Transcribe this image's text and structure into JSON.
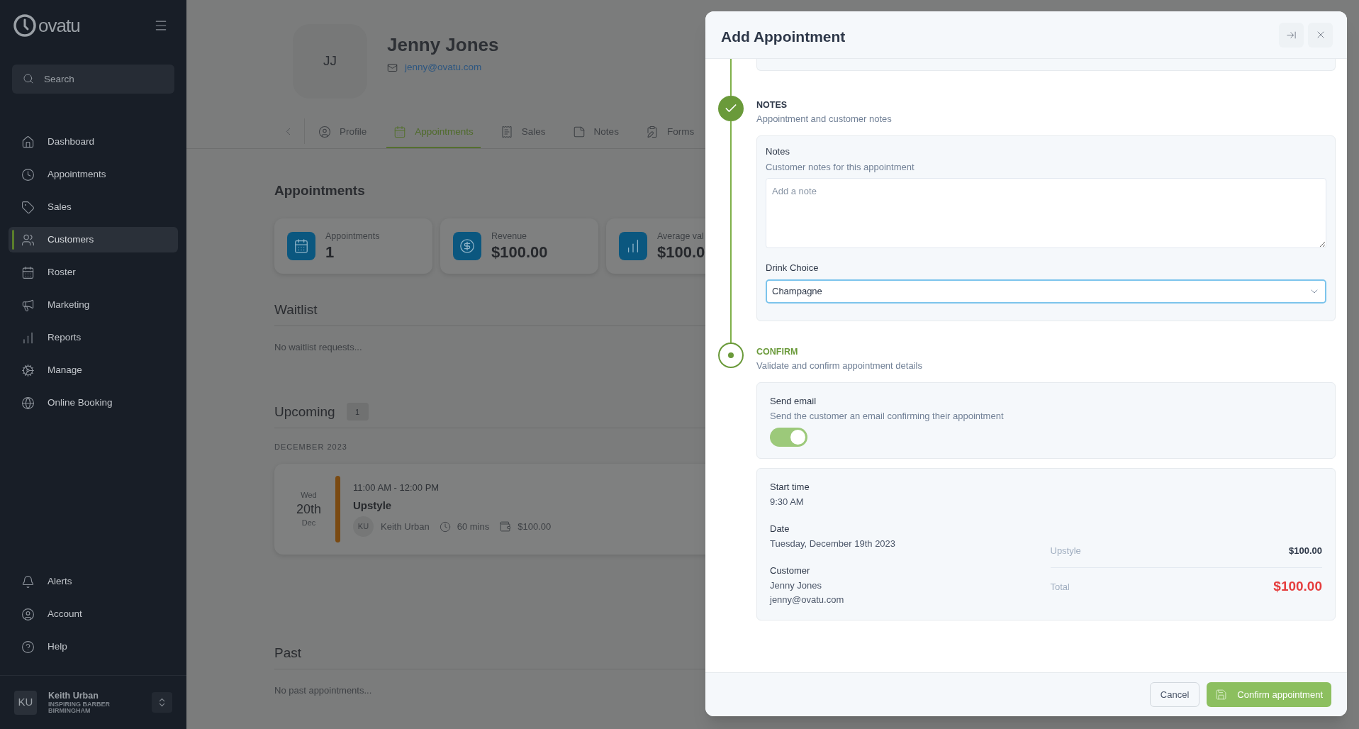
{
  "sidebar": {
    "logo": "ovatu",
    "search": {
      "placeholder": "Search"
    },
    "nav": [
      {
        "label": "Dashboard",
        "selected": false
      },
      {
        "label": "Appointments",
        "selected": false
      },
      {
        "label": "Sales",
        "selected": false
      },
      {
        "label": "Customers",
        "selected": true
      },
      {
        "label": "Roster",
        "selected": false
      },
      {
        "label": "Marketing",
        "selected": false
      },
      {
        "label": "Reports",
        "selected": false
      },
      {
        "label": "Manage",
        "selected": false
      },
      {
        "label": "Online Booking",
        "selected": false
      }
    ],
    "bottom_nav": [
      {
        "label": "Alerts",
        "selected": false
      },
      {
        "label": "Account",
        "selected": false
      },
      {
        "label": "Help",
        "selected": false
      }
    ],
    "user": {
      "initials": "KU",
      "name": "Keith Urban",
      "org": "INSPIRING BARBER BIRMINGHAM"
    }
  },
  "customer": {
    "initials": "JJ",
    "name": "Jenny Jones",
    "email": "jenny@ovatu.com",
    "tabs": [
      {
        "label": "Profile",
        "selected": false
      },
      {
        "label": "Appointments",
        "selected": true
      },
      {
        "label": "Sales",
        "selected": false
      },
      {
        "label": "Notes",
        "selected": false
      },
      {
        "label": "Forms",
        "selected": false
      }
    ]
  },
  "appointments": {
    "title": "Appointments",
    "stats": [
      {
        "label": "Appointments",
        "value": "1"
      },
      {
        "label": "Revenue",
        "value": "$100.00"
      },
      {
        "label": "Average val",
        "value": "$100.0"
      }
    ]
  },
  "waitlist": {
    "title": "Waitlist",
    "empty": "No waitlist requests..."
  },
  "upcoming": {
    "title": "Upcoming",
    "count": "1",
    "month": "DECEMBER 2023",
    "items": [
      {
        "weekday": "Wed",
        "day": "20th",
        "month": "Dec",
        "color": "#7a4a12",
        "time": "11:00 AM - 12:00 PM",
        "service": "Upstyle",
        "staff_initials": "KU",
        "staff": "Keith Urban",
        "duration": "60 mins",
        "price": "$100.00"
      }
    ]
  },
  "past": {
    "title": "Past",
    "empty": "No past appointments..."
  },
  "modal": {
    "title": "Add Appointment",
    "notes_step": {
      "kind": "done",
      "title": "NOTES",
      "subtitle": "Appointment and customer notes",
      "notes": {
        "label": "Notes",
        "description": "Customer notes for this appointment",
        "placeholder": "Add a note"
      },
      "drink": {
        "label": "Drink Choice",
        "value": "Champagne"
      }
    },
    "confirm_step": {
      "kind": "current",
      "title": "CONFIRM",
      "subtitle": "Validate and confirm appointment details",
      "send_email": {
        "label": "Send email",
        "description": "Send the customer an email confirming their appointment",
        "on": true
      },
      "summary": {
        "start_label": "Start time",
        "start": "9:30 AM",
        "date_label": "Date",
        "date": "Tuesday, December 19th 2023",
        "customer_label": "Customer",
        "customer_name": "Jenny Jones",
        "customer_email": "jenny@ovatu.com",
        "lines": [
          {
            "label": "Upstyle",
            "value": "$100.00"
          }
        ],
        "total_label": "Total",
        "total": "$100.00"
      }
    },
    "cancel": "Cancel",
    "confirm": "Confirm appointment"
  }
}
